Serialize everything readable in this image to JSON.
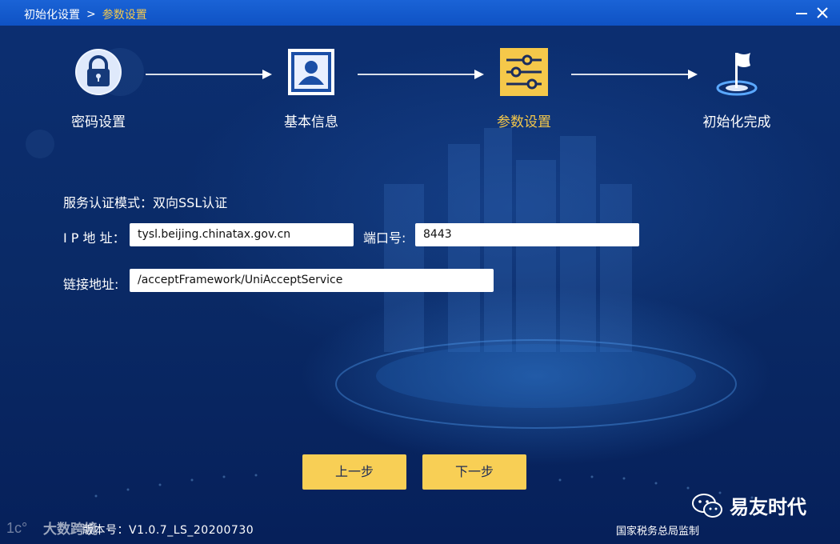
{
  "titlebar": {
    "breadcrumb_root": "初始化设置",
    "separator": ">",
    "breadcrumb_current": "参数设置",
    "minimize_icon": "minimize-icon",
    "close_icon": "close-icon"
  },
  "steps": [
    {
      "label": "密码设置",
      "icon": "lock-icon",
      "active": false
    },
    {
      "label": "基本信息",
      "icon": "user-card-icon",
      "active": false
    },
    {
      "label": "参数设置",
      "icon": "sliders-icon",
      "active": true
    },
    {
      "label": "初始化完成",
      "icon": "flag-icon",
      "active": false
    }
  ],
  "form": {
    "auth_mode_label": "服务认证模式：",
    "auth_mode_value": "双向SSL认证",
    "ip_label": "I P 地 址：",
    "ip_value": "tysl.beijing.chinatax.gov.cn",
    "port_label": "端口号:",
    "port_value": "8443",
    "link_label": "链接地址:",
    "link_value": "/acceptFramework/UniAcceptService"
  },
  "buttons": {
    "prev": "上一步",
    "next": "下一步"
  },
  "footer": {
    "version": "版本号：V1.0.7_LS_20200730",
    "supervisor": "国家税务总局监制",
    "watermark_left": "大数跨境",
    "watermark_right": "易友时代"
  },
  "colors": {
    "accent": "#f5c84a",
    "titlebar": "#1560d0",
    "background": "#0a2a66"
  }
}
